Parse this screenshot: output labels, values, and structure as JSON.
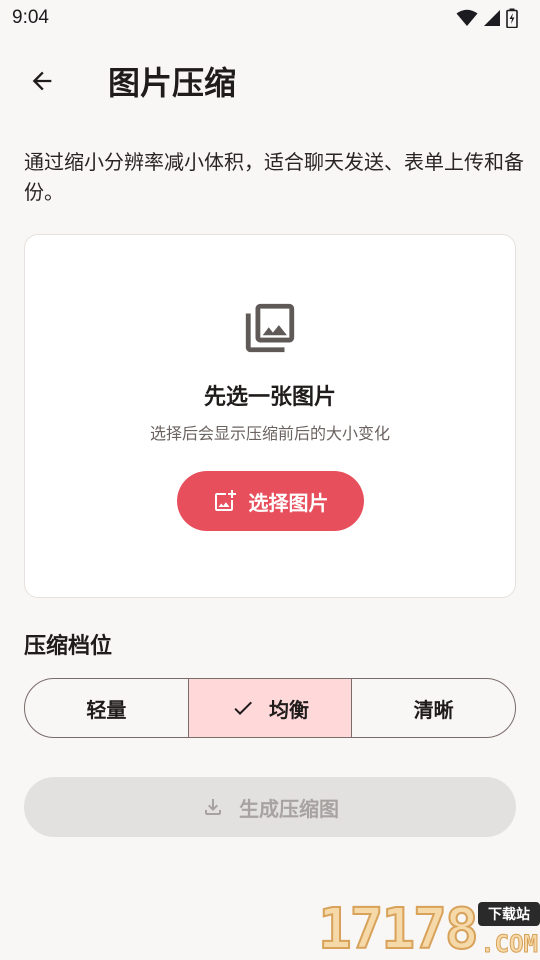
{
  "status_bar": {
    "time": "9:04",
    "icons": [
      "wifi-icon",
      "signal-icon",
      "battery-charging-icon"
    ]
  },
  "app_bar": {
    "back_icon": "arrow-back-icon",
    "title": "图片压缩"
  },
  "description": "通过缩小分辨率减小体积，适合聊天发送、表单上传和备份。",
  "picker": {
    "icon": "photo-library-icon",
    "title": "先选一张图片",
    "hint": "选择后会显示压缩前后的大小变化",
    "button_label": "选择图片",
    "button_icon": "add-photo-icon"
  },
  "compression": {
    "section_title": "压缩档位",
    "options": [
      {
        "label": "轻量",
        "selected": false
      },
      {
        "label": "均衡",
        "selected": true
      },
      {
        "label": "清晰",
        "selected": false
      }
    ],
    "selected_icon": "check-icon"
  },
  "generate": {
    "label": "生成压缩图",
    "icon": "download-icon",
    "enabled": false
  },
  "watermark": {
    "digits": "17178",
    "badge": "下载站",
    "suffix": ".COM"
  },
  "colors": {
    "background": "#f8f7f5",
    "accent": "#e84f5d",
    "selected_segment": "#ffd9da",
    "disabled_button": "#e3e1df",
    "disabled_text": "#a8a3a1"
  }
}
